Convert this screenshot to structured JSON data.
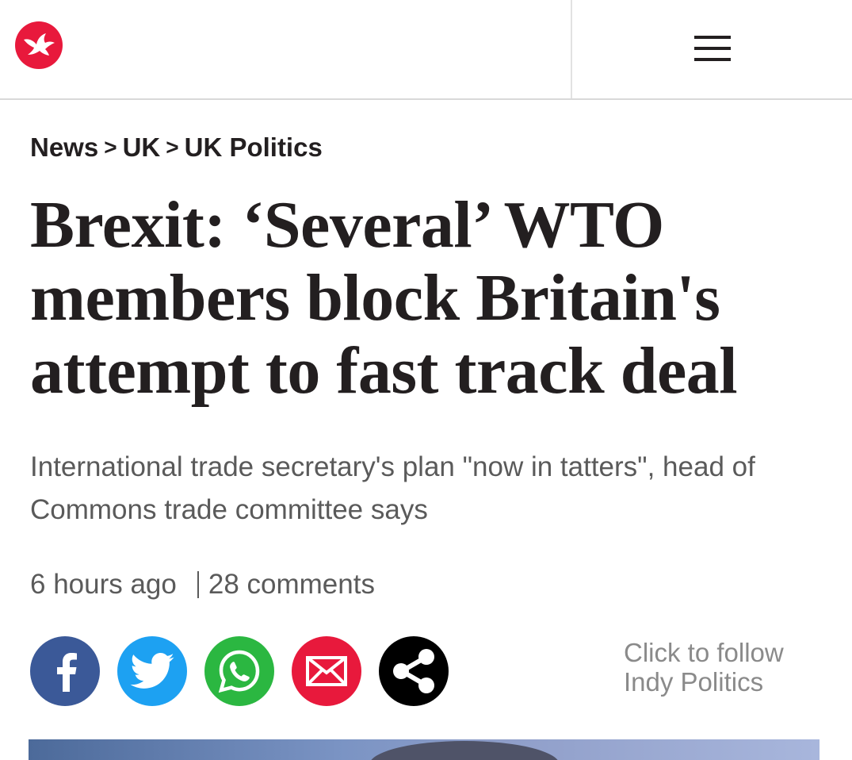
{
  "header": {
    "logo_icon": "independent-eagle-logo-icon",
    "menu_icon": "hamburger-menu-icon",
    "brand_color": "#e8193c"
  },
  "breadcrumb": {
    "items": [
      "News",
      "UK",
      "UK Politics"
    ],
    "separator": ">"
  },
  "article": {
    "headline": "Brexit: ‘Several’ WTO members block Britain's attempt to fast track deal",
    "standfirst": "International trade secretary's plan \"now in tatters\", head of Commons trade committee says",
    "time_ago": "6 hours ago",
    "comments": "28 comments"
  },
  "share": {
    "buttons": [
      {
        "name": "facebook",
        "icon": "facebook-icon",
        "color": "#3b5998"
      },
      {
        "name": "twitter",
        "icon": "twitter-icon",
        "color": "#1da1f2"
      },
      {
        "name": "whatsapp",
        "icon": "whatsapp-icon",
        "color": "#2bb741"
      },
      {
        "name": "email",
        "icon": "email-icon",
        "color": "#e8193c"
      },
      {
        "name": "share",
        "icon": "share-icon",
        "color": "#000000"
      }
    ]
  },
  "follow": {
    "line1": "Click to follow",
    "line2": "Indy Politics"
  }
}
